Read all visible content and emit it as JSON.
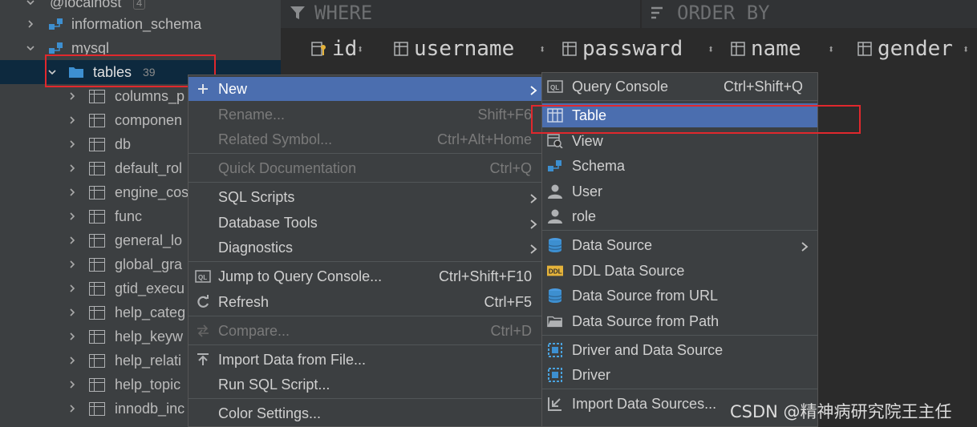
{
  "tree": {
    "connection_label": "@localhost",
    "connection_count": "4",
    "schemas": [
      {
        "label": "information_schema"
      },
      {
        "label": "mysql"
      }
    ],
    "tables_folder": {
      "label": "tables",
      "count": "39"
    },
    "tables": [
      "columns_p",
      "componen",
      "db",
      "default_rol",
      "engine_cos",
      "func",
      "general_lo",
      "global_gra",
      "gtid_execu",
      "help_categ",
      "help_keyw",
      "help_relati",
      "help_topic",
      "innodb_inc"
    ]
  },
  "filterbar": {
    "where": "WHERE",
    "order_by": "ORDER BY"
  },
  "columns": [
    "id",
    "username",
    "passward",
    "name",
    "gender"
  ],
  "context_menu": {
    "items": [
      {
        "label": "New",
        "shortcut": "",
        "submenu": true,
        "state": "highlight",
        "icon": "plus-icon"
      },
      {
        "label": "Rename...",
        "shortcut": "Shift+F6",
        "state": "disabled"
      },
      {
        "label": "Related Symbol...",
        "shortcut": "Ctrl+Alt+Home",
        "state": "disabled"
      },
      {
        "label": "Quick Documentation",
        "shortcut": "Ctrl+Q",
        "state": "disabled"
      },
      {
        "label": "SQL Scripts",
        "submenu": true
      },
      {
        "label": "Database Tools",
        "submenu": true
      },
      {
        "label": "Diagnostics",
        "submenu": true
      },
      {
        "label": "Jump to Query Console...",
        "shortcut": "Ctrl+Shift+F10",
        "icon": "ql-icon"
      },
      {
        "label": "Refresh",
        "shortcut": "Ctrl+F5",
        "icon": "refresh-icon"
      },
      {
        "label": "Compare...",
        "shortcut": "Ctrl+D",
        "state": "disabled",
        "icon": "compare-icon"
      },
      {
        "label": "Import Data from File...",
        "icon": "import-icon"
      },
      {
        "label": "Run SQL Script..."
      },
      {
        "label": "Color Settings..."
      }
    ]
  },
  "new_submenu": {
    "items": [
      {
        "label": "Query Console",
        "shortcut": "Ctrl+Shift+Q",
        "icon": "ql-icon"
      },
      {
        "label": "Table",
        "state": "highlight",
        "icon": "table-icon"
      },
      {
        "label": "View",
        "icon": "view-icon"
      },
      {
        "label": "Schema",
        "icon": "schema-icon"
      },
      {
        "label": "User",
        "icon": "user-icon"
      },
      {
        "label": "role",
        "icon": "user-icon"
      },
      {
        "label": "Data Source",
        "submenu": true,
        "icon": "database-icon"
      },
      {
        "label": "DDL Data Source",
        "icon": "ddl-icon"
      },
      {
        "label": "Data Source from URL",
        "icon": "database-icon"
      },
      {
        "label": "Data Source from Path",
        "icon": "folder-icon"
      },
      {
        "label": "Driver and Data Source",
        "icon": "driver-icon"
      },
      {
        "label": "Driver",
        "icon": "driver-icon"
      },
      {
        "label": "Import Data Sources...",
        "icon": "import-arrow-icon"
      }
    ]
  },
  "watermark": "CSDN @精神病研究院王主任",
  "colors": {
    "highlight": "#4b6eaf",
    "annotation": "#e0282d",
    "folder": "#3d8fd0"
  }
}
